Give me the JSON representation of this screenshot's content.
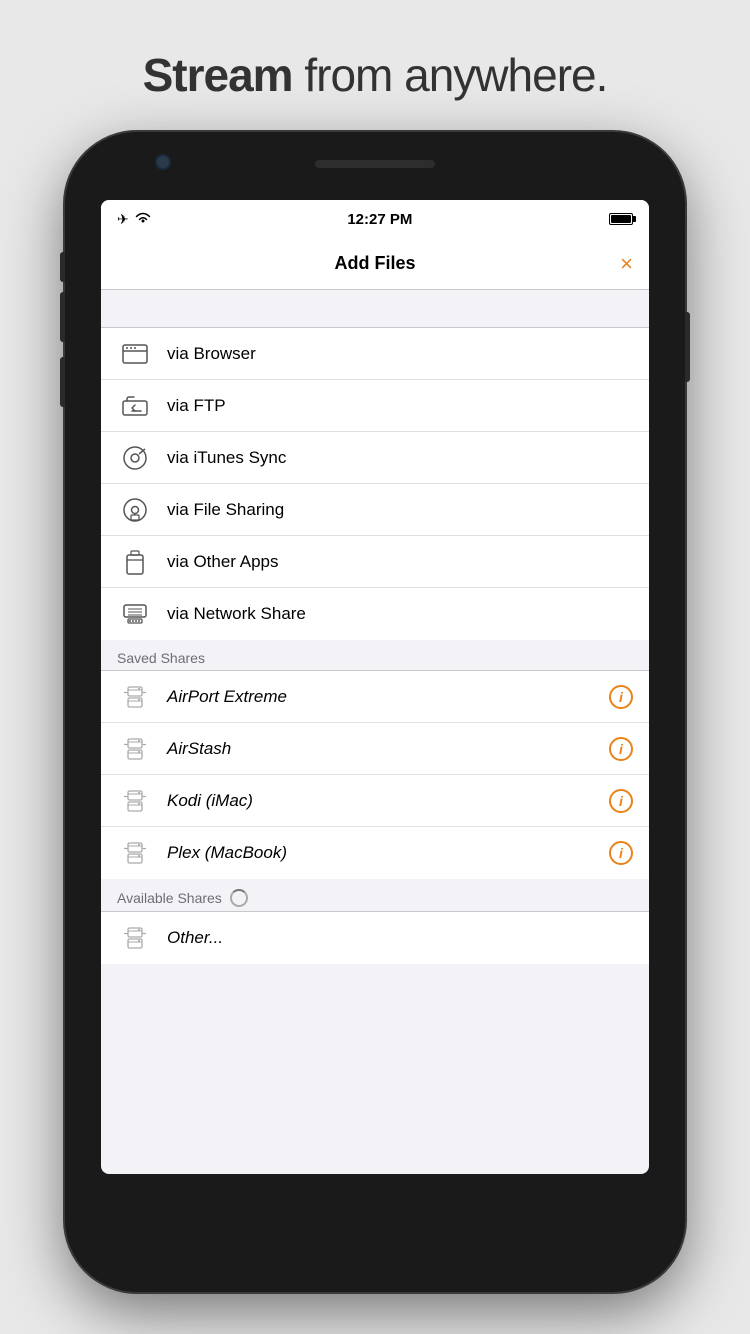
{
  "tagline": {
    "bold": "Stream",
    "rest": " from anywhere."
  },
  "statusBar": {
    "time": "12:27 PM",
    "airplaneMode": "✈",
    "wifi": "wifi"
  },
  "navBar": {
    "title": "Add Files",
    "closeLabel": "×"
  },
  "addOptions": [
    {
      "id": "browser",
      "label": "via Browser",
      "icon": "browser"
    },
    {
      "id": "ftp",
      "label": "via FTP",
      "icon": "ftp"
    },
    {
      "id": "itunes",
      "label": "via iTunes Sync",
      "icon": "itunes"
    },
    {
      "id": "filesharing",
      "label": "via File Sharing",
      "icon": "filesharing"
    },
    {
      "id": "otherapps",
      "label": "via Other Apps",
      "icon": "otherapps"
    },
    {
      "id": "networkshare",
      "label": "via Network Share",
      "icon": "networkshare"
    }
  ],
  "savedSharesLabel": "Saved Shares",
  "savedShares": [
    {
      "id": "airport",
      "label": "AirPort Extreme"
    },
    {
      "id": "airstash",
      "label": "AirStash"
    },
    {
      "id": "kodi",
      "label": "Kodi (iMac)"
    },
    {
      "id": "plex",
      "label": "Plex (MacBook)"
    }
  ],
  "availableSharesLabel": "Available Shares",
  "availableShares": [
    {
      "id": "other",
      "label": "Other..."
    }
  ]
}
